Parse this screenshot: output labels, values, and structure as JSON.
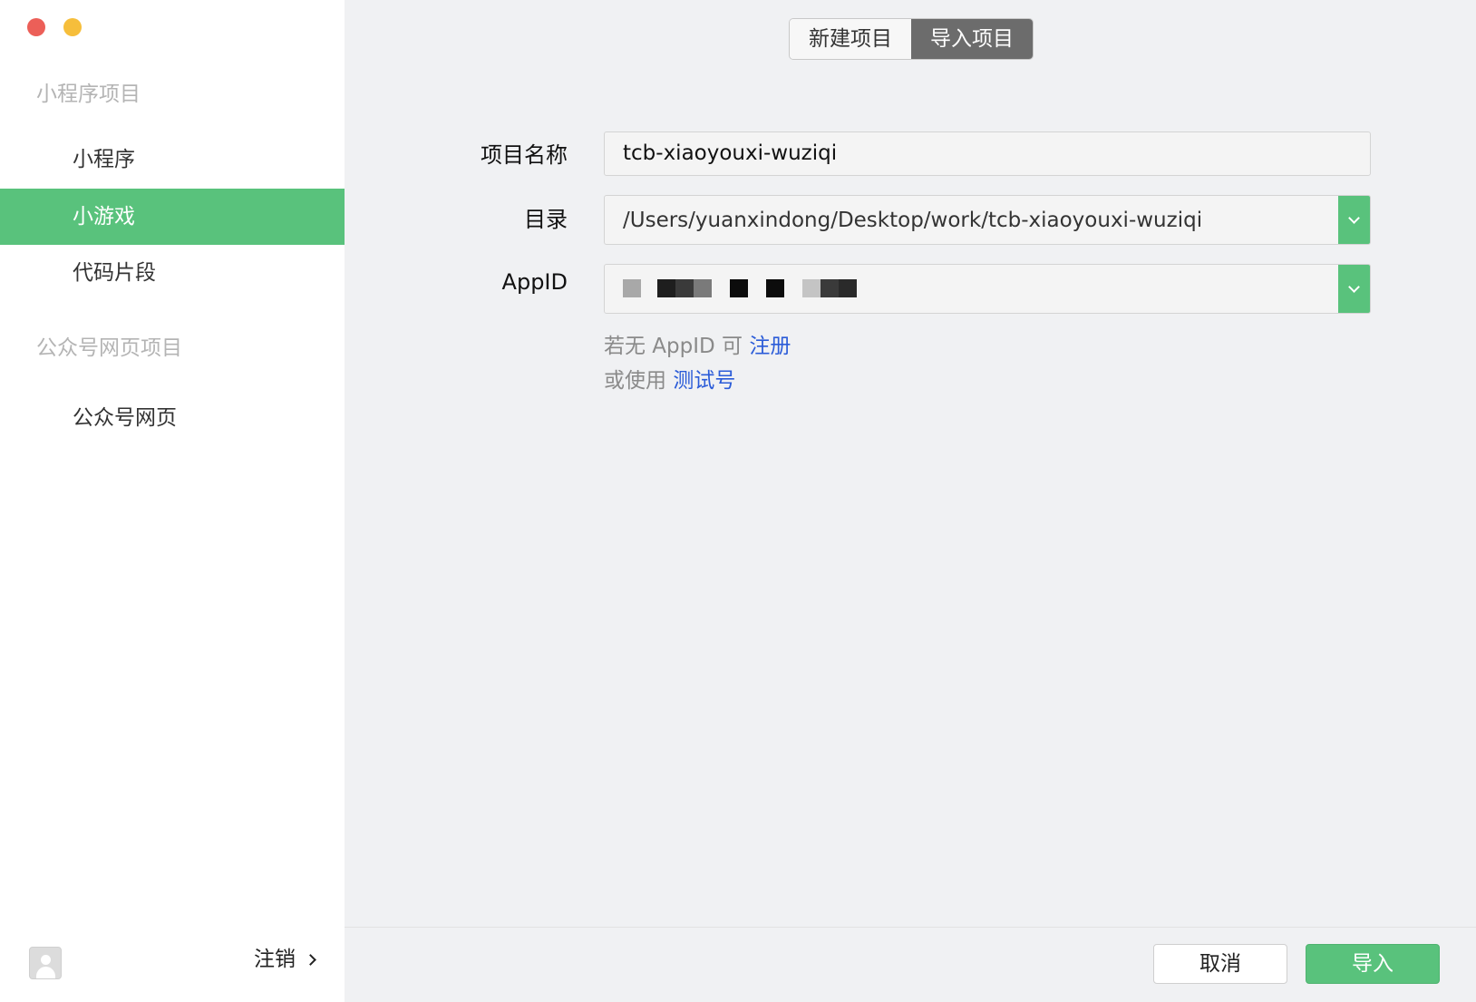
{
  "window": {
    "traffic_lights": [
      "close",
      "minimize"
    ]
  },
  "sidebar": {
    "sections": [
      {
        "title": "小程序项目",
        "items": [
          "小程序",
          "小游戏",
          "代码片段"
        ]
      },
      {
        "title": "公众号网页项目",
        "items": [
          "公众号网页"
        ]
      }
    ],
    "active_item": "小游戏",
    "logout_label": "注销"
  },
  "tabs": {
    "new_project": "新建项目",
    "import_project": "导入项目",
    "active": "导入项目"
  },
  "form": {
    "project_name_label": "项目名称",
    "project_name_value": "tcb-xiaoyouxi-wuziqi",
    "directory_label": "目录",
    "directory_value": "/Users/yuanxindong/Desktop/work/tcb-xiaoyouxi-wuziqi",
    "appid_label": "AppID",
    "appid_value_redacted": true
  },
  "hints": {
    "no_appid_prefix": "若无 AppID 可",
    "register_link": "注册",
    "use_prefix": "或使用",
    "test_account_link": "测试号"
  },
  "footer": {
    "cancel_label": "取消",
    "import_label": "导入"
  },
  "colors": {
    "accent_green": "#59c27c",
    "link_blue": "#2b5cd8",
    "tab_active_bg": "#6c6c6c"
  }
}
